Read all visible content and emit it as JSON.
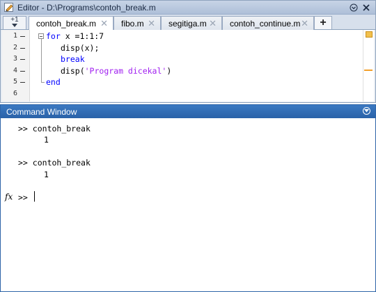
{
  "editor": {
    "title": "Editor - D:\\Programs\\contoh_break.m",
    "nav_glyph": "+1",
    "tabs": [
      {
        "label": "contoh_break.m",
        "active": true
      },
      {
        "label": "fibo.m",
        "active": false
      },
      {
        "label": "segitiga.m",
        "active": false
      },
      {
        "label": "contoh_continue.m",
        "active": false
      }
    ],
    "tab_close_glyph": "✕",
    "add_tab_label": "+",
    "line_numbers": [
      "1",
      "2",
      "3",
      "4",
      "5",
      "6"
    ],
    "code": {
      "l1_kw": "for",
      "l1_rest": " x =1:1:7",
      "l2": "disp(x);",
      "l3_kw": "break",
      "l4_pre": "disp(",
      "l4_str": "'Program dicekal'",
      "l4_post": ")",
      "l5_kw": "end"
    },
    "colors": {
      "keyword": "#0000ff",
      "string": "#a020f0",
      "warning": "#f29f2a"
    }
  },
  "command_window": {
    "title": "Command Window",
    "prompt": ">>",
    "entries": [
      {
        "command": "contoh_break",
        "output": "1"
      },
      {
        "command": "contoh_break",
        "output": "1"
      }
    ],
    "fx_label": "fx",
    "title_bar_color": "#2a62a8"
  }
}
